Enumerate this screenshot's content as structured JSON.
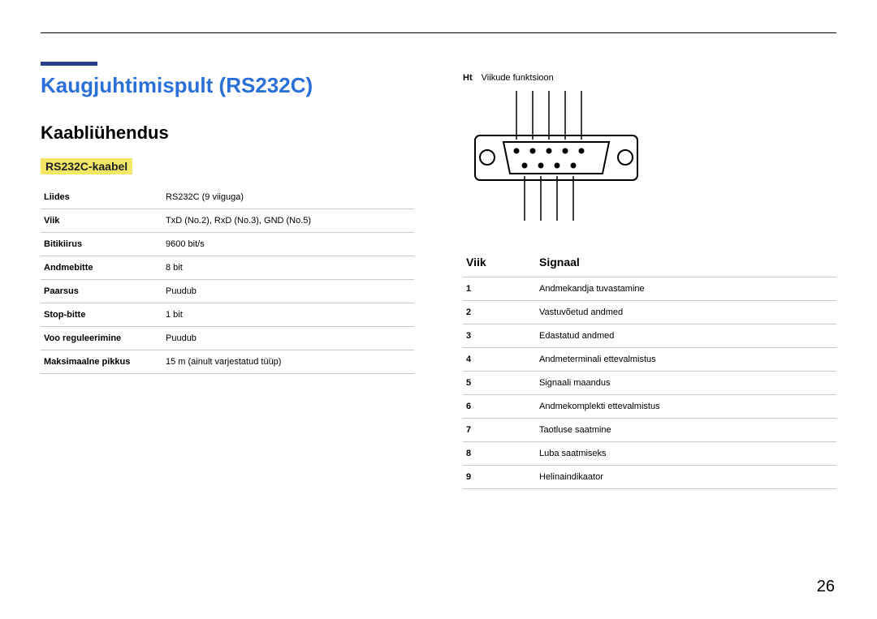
{
  "page_number": "26",
  "title": "Kaugjuhtimispult (RS232C)",
  "section": "Kaabliühendus",
  "subsection": "RS232C-kaabel",
  "spec_rows": [
    {
      "k": "Liides",
      "v": "RS232C (9 viiguga)"
    },
    {
      "k": "Viik",
      "v": "TxD (No.2), RxD (No.3), GND (No.5)"
    },
    {
      "k": "Bitikiirus",
      "v": "9600 bit/s"
    },
    {
      "k": "Andmebitte",
      "v": "8 bit"
    },
    {
      "k": "Paarsus",
      "v": "Puudub"
    },
    {
      "k": "Stop-bitte",
      "v": "1 bit"
    },
    {
      "k": "Voo reguleerimine",
      "v": "Puudub"
    },
    {
      "k": "Maksimaalne pikkus",
      "v": "15 m (ainult varjestatud tüüp)"
    }
  ],
  "pin_note_prefix": "Ht",
  "pin_note": "Viikude funktsioon",
  "pin_header_pin": "Viik",
  "pin_header_signal": "Signaal",
  "pin_rows": [
    {
      "n": "1",
      "s": "Andmekandja tuvastamine"
    },
    {
      "n": "2",
      "s": "Vastuvõetud andmed"
    },
    {
      "n": "3",
      "s": "Edastatud andmed"
    },
    {
      "n": "4",
      "s": "Andmeterminali ettevalmistus"
    },
    {
      "n": "5",
      "s": "Signaali maandus"
    },
    {
      "n": "6",
      "s": "Andmekomplekti ettevalmistus"
    },
    {
      "n": "7",
      "s": "Taotluse saatmine"
    },
    {
      "n": "8",
      "s": "Luba saatmiseks"
    },
    {
      "n": "9",
      "s": "Helinaindikaator"
    }
  ]
}
